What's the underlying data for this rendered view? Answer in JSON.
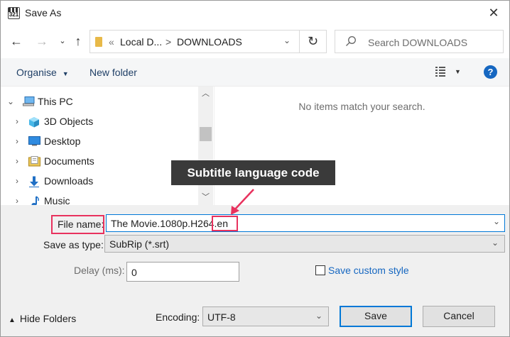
{
  "window": {
    "title": "Save As",
    "icon_text": "321"
  },
  "nav": {
    "back_icon": "arrow-left-icon",
    "forward_icon": "arrow-right-icon",
    "recent_icon": "chevron-down-icon",
    "up_icon": "arrow-up-icon",
    "address": {
      "overflow": "«",
      "segment_1": "Local D...",
      "separator": ">",
      "segment_2": "DOWNLOADS"
    },
    "refresh_icon": "refresh-icon",
    "search_placeholder": "Search DOWNLOADS"
  },
  "toolbar": {
    "organise_label": "Organise",
    "new_folder_label": "New folder",
    "help_label": "?"
  },
  "tree": {
    "items": [
      {
        "label": "This PC",
        "icon": "computer-icon",
        "chevron": "expanded"
      },
      {
        "label": "3D Objects",
        "icon": "cube-icon",
        "chevron": "collapsed"
      },
      {
        "label": "Desktop",
        "icon": "desktop-icon",
        "chevron": "collapsed"
      },
      {
        "label": "Documents",
        "icon": "documents-icon",
        "chevron": "collapsed"
      },
      {
        "label": "Downloads",
        "icon": "download-icon",
        "chevron": "collapsed"
      },
      {
        "label": "Music",
        "icon": "music-icon",
        "chevron": "collapsed"
      }
    ]
  },
  "content": {
    "empty_message": "No items match your search."
  },
  "form": {
    "file_name_label": "File name:",
    "file_name_value_main": "The Movie.1080p.H264",
    "file_name_value_ext": ".en",
    "save_type_label": "Save as type:",
    "save_type_value": "SubRip (*.srt)",
    "delay_label": "Delay (ms):",
    "delay_value": "0",
    "custom_style_label": "Save custom style",
    "hide_folders_label": "Hide Folders",
    "encoding_label": "Encoding:",
    "encoding_value": "UTF-8",
    "save_label": "Save",
    "cancel_label": "Cancel"
  },
  "annotation": {
    "callout_text": "Subtitle language code",
    "color": "#e8325e"
  }
}
